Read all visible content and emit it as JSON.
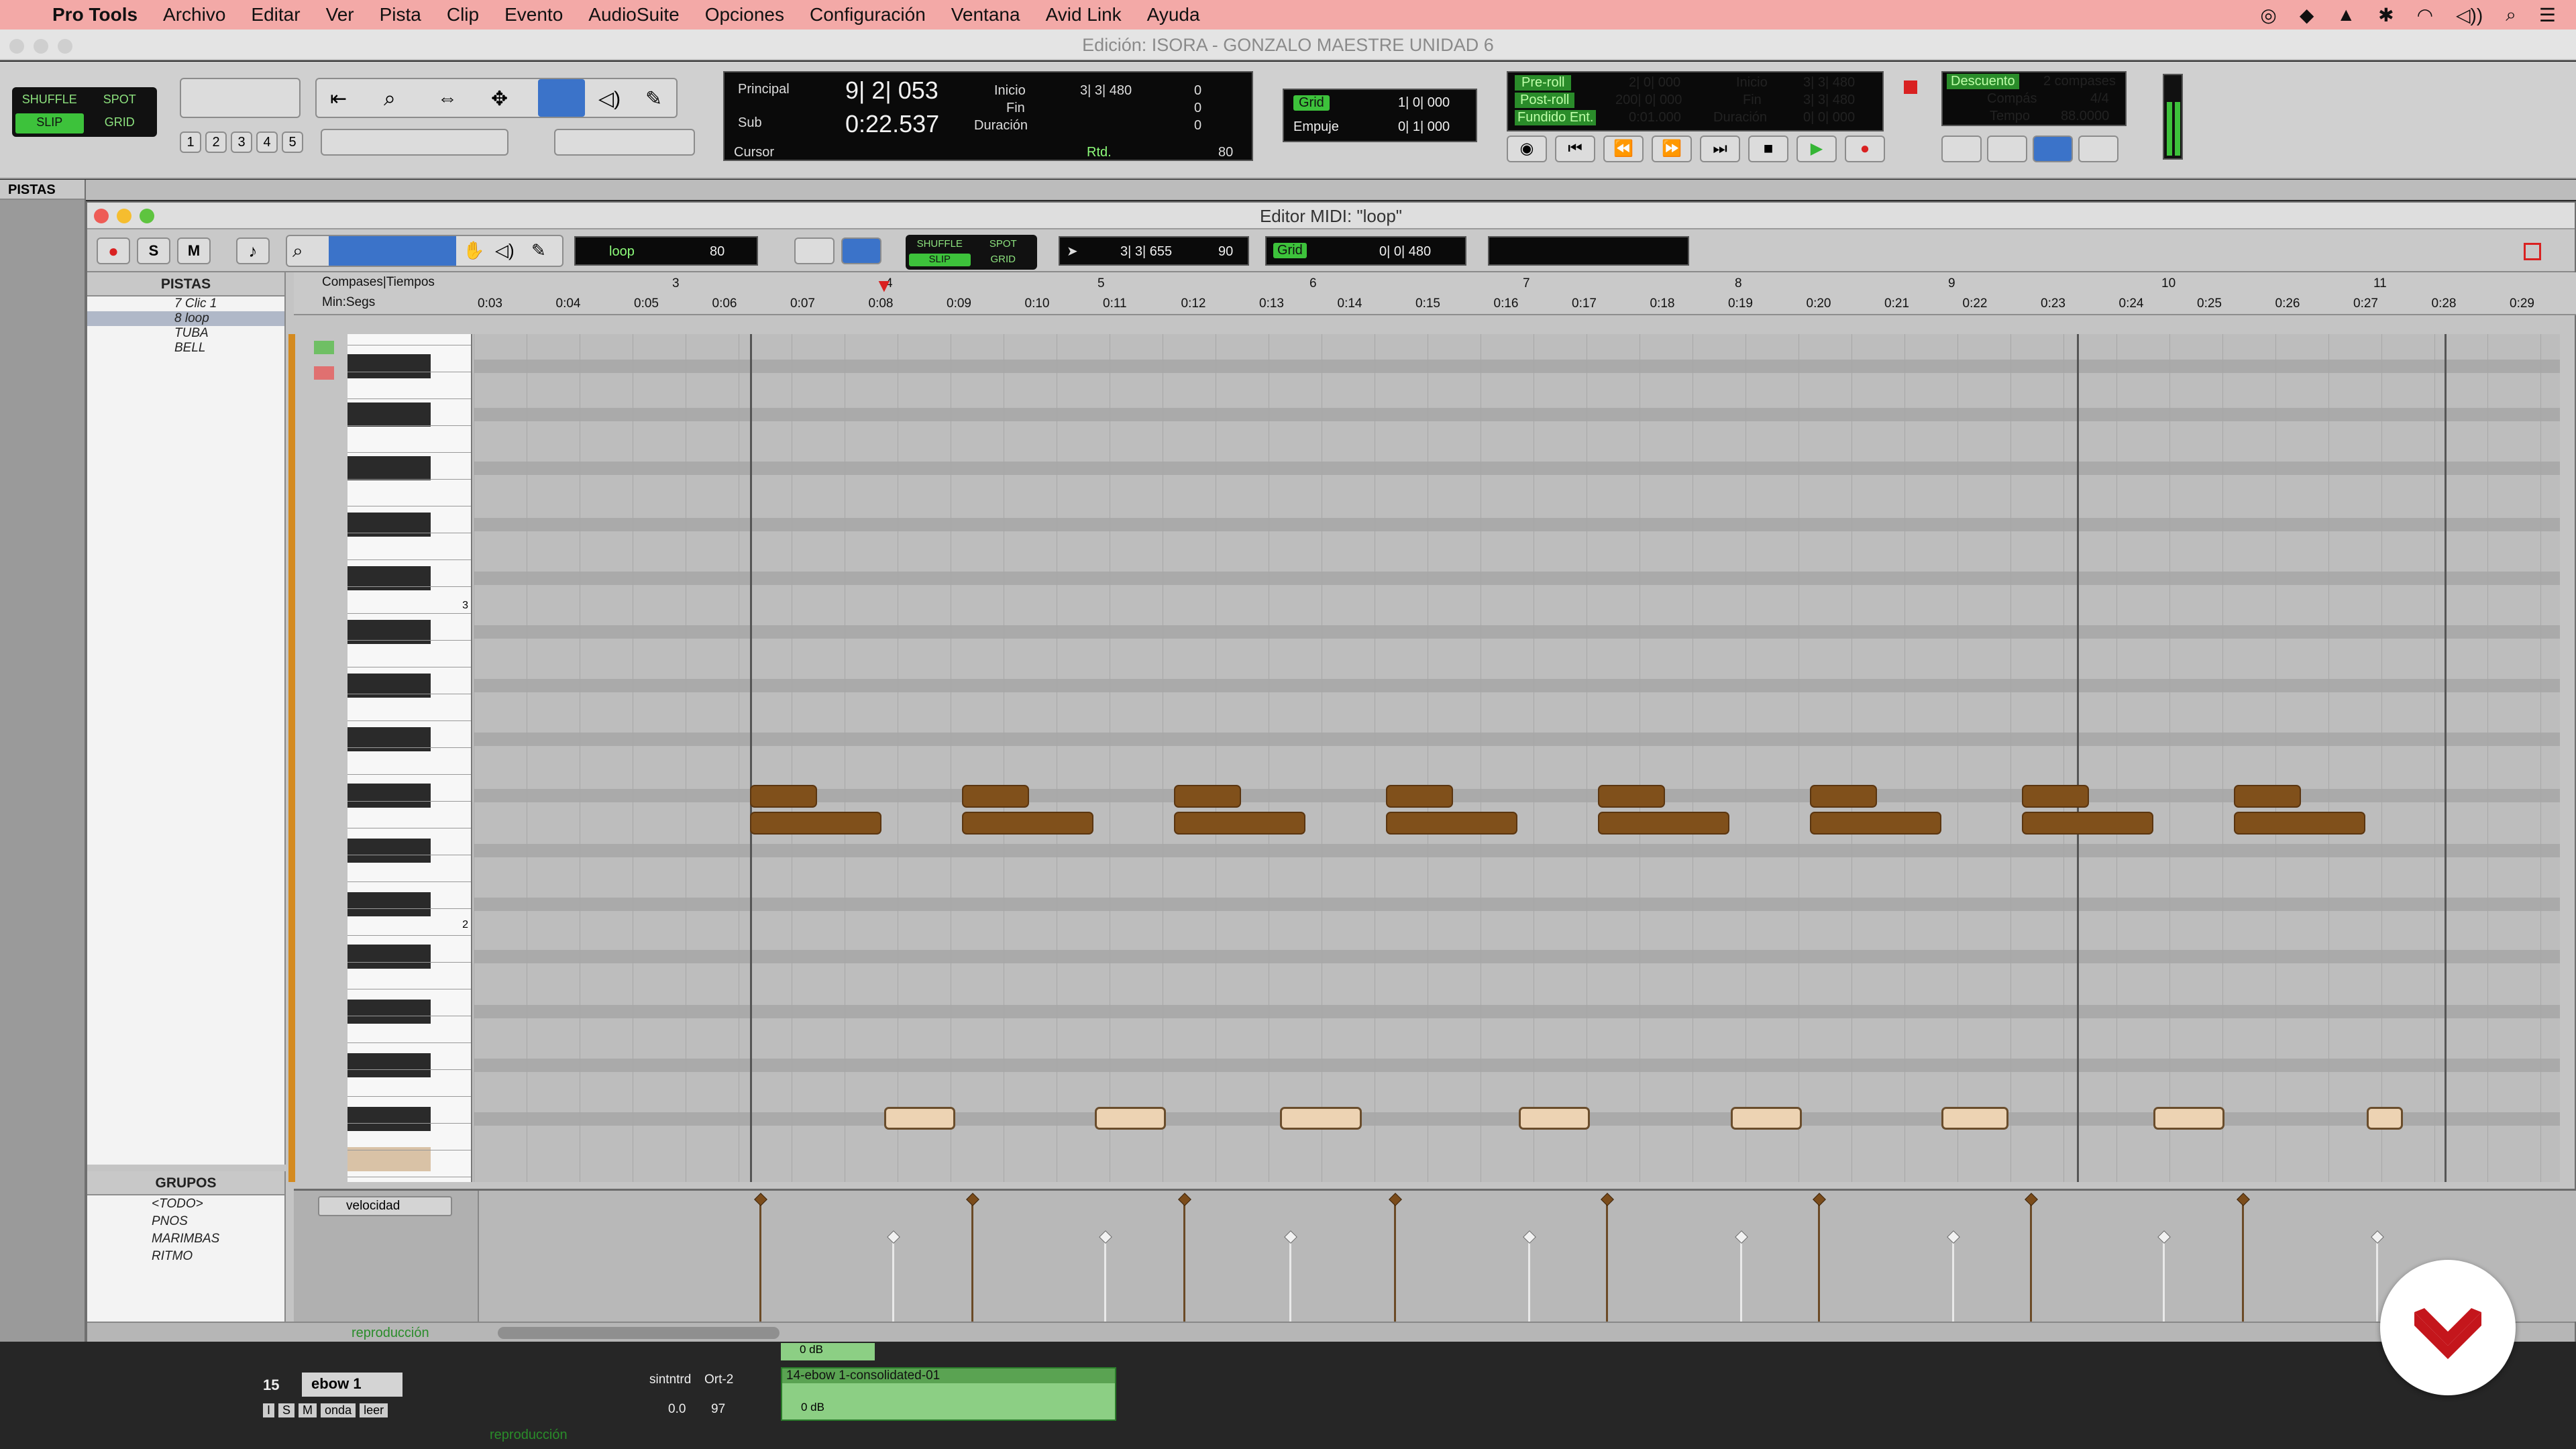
{
  "menubar": {
    "app": "Pro Tools",
    "items": [
      "Archivo",
      "Editar",
      "Ver",
      "Pista",
      "Clip",
      "Evento",
      "AudioSuite",
      "Opciones",
      "Configuración",
      "Ventana",
      "Avid Link",
      "Ayuda"
    ]
  },
  "edit_window": {
    "title": "Edición: ISORA - GONZALO MAESTRE UNIDAD 6",
    "tracks_header": "PISTAS"
  },
  "edit_modes": {
    "shuffle": "SHUFFLE",
    "spot": "SPOT",
    "slip": "SLIP",
    "grid": "GRID"
  },
  "zoom_presets": [
    "1",
    "2",
    "3",
    "4",
    "5"
  ],
  "counters": {
    "main_label": "Principal",
    "main_value": "9| 2| 053",
    "sub_label": "Sub",
    "sub_value": "0:22.537",
    "cursor_label": "Cursor",
    "start_label": "Inicio",
    "end_label": "Fin",
    "length_label": "Duración",
    "start_value": "3| 3| 480",
    "nudge_values": [
      "0",
      "0",
      "0"
    ],
    "tempo_small": "80",
    "rtd_label": "Rtd."
  },
  "grid_nudge": {
    "grid_label": "Grid",
    "grid_value": "1| 0| 000",
    "nudge_label": "Empuje",
    "nudge_value": "0| 1| 000"
  },
  "preroll": {
    "preroll_label": "Pre-roll",
    "preroll_value": "2| 0| 000",
    "postroll_label": "Post-roll",
    "postroll_value": "200| 0| 000",
    "fade_label": "Fundido Ent.",
    "fade_value": "0:01.000",
    "start_label": "Inicio",
    "start_value": "3| 3| 480",
    "end_label": "Fin",
    "end_value": "3| 3| 480",
    "length_label": "Duración",
    "length_value": "0| 0| 000"
  },
  "countoff": {
    "label": "Descuento",
    "value": "2 compases",
    "meter_label": "Compás",
    "meter_value": "4/4",
    "tempo_label": "Tempo",
    "tempo_value": "88.0000"
  },
  "midi_editor": {
    "title": "Editor MIDI: \"loop\"",
    "track_select": "loop",
    "velocity_small": "80",
    "position": "3| 3| 655",
    "position_vel": "90",
    "grid_label": "Grid",
    "grid_value": "0| 0| 480",
    "tracks_header": "PISTAS",
    "tracks": [
      {
        "num": "7",
        "name": "Clic 1"
      },
      {
        "num": "8",
        "name": "loop"
      },
      {
        "num": "",
        "name": "TUBA"
      },
      {
        "num": "",
        "name": "BELL"
      }
    ],
    "groups_header": "GRUPOS",
    "groups": [
      {
        "id": "!",
        "name": "<TODO>"
      },
      {
        "id": "a",
        "name": "PNOS"
      },
      {
        "id": "b",
        "name": "MARIMBAS"
      },
      {
        "id": "c",
        "name": "RITMO"
      }
    ],
    "ruler_bars_label": "Compases|Tiempos",
    "ruler_time_label": "Min:Segs",
    "bars": [
      "3",
      "4",
      "5",
      "6",
      "7",
      "8",
      "9",
      "10",
      "11"
    ],
    "times": [
      "0:03",
      "0:04",
      "0:05",
      "0:06",
      "0:07",
      "0:08",
      "0:09",
      "0:10",
      "0:11",
      "0:12",
      "0:13",
      "0:14",
      "0:15",
      "0:16",
      "0:17",
      "0:18",
      "0:19",
      "0:20",
      "0:21",
      "0:22",
      "0:23",
      "0:24",
      "0:25",
      "0:26",
      "0:27",
      "0:28",
      "0:29"
    ],
    "octave_labels": [
      "3",
      "2"
    ],
    "velocity_lane_label": "velocidad",
    "footer_label": "reproducción"
  },
  "bottom_track": {
    "num": "15",
    "name": "ebow 1",
    "mode": "onda",
    "insert": "sintntrd",
    "out": "Ort-2",
    "vol": "0.0",
    "pan": "97",
    "clip_name": "14-ebow 1-consolidated-01",
    "clip_gain": "0 dB",
    "clip_gain2": "0 dB",
    "footer_label": "reproducción",
    "row_labels": [
      "I",
      "S",
      "M",
      "onda",
      "leer"
    ]
  },
  "colors": {
    "menubar": "#f3a9a7",
    "note": "#80501b",
    "note_selected": "#edd3b3",
    "record": "#d92121",
    "play": "#35b535",
    "mode_active": "#3dc23b"
  }
}
